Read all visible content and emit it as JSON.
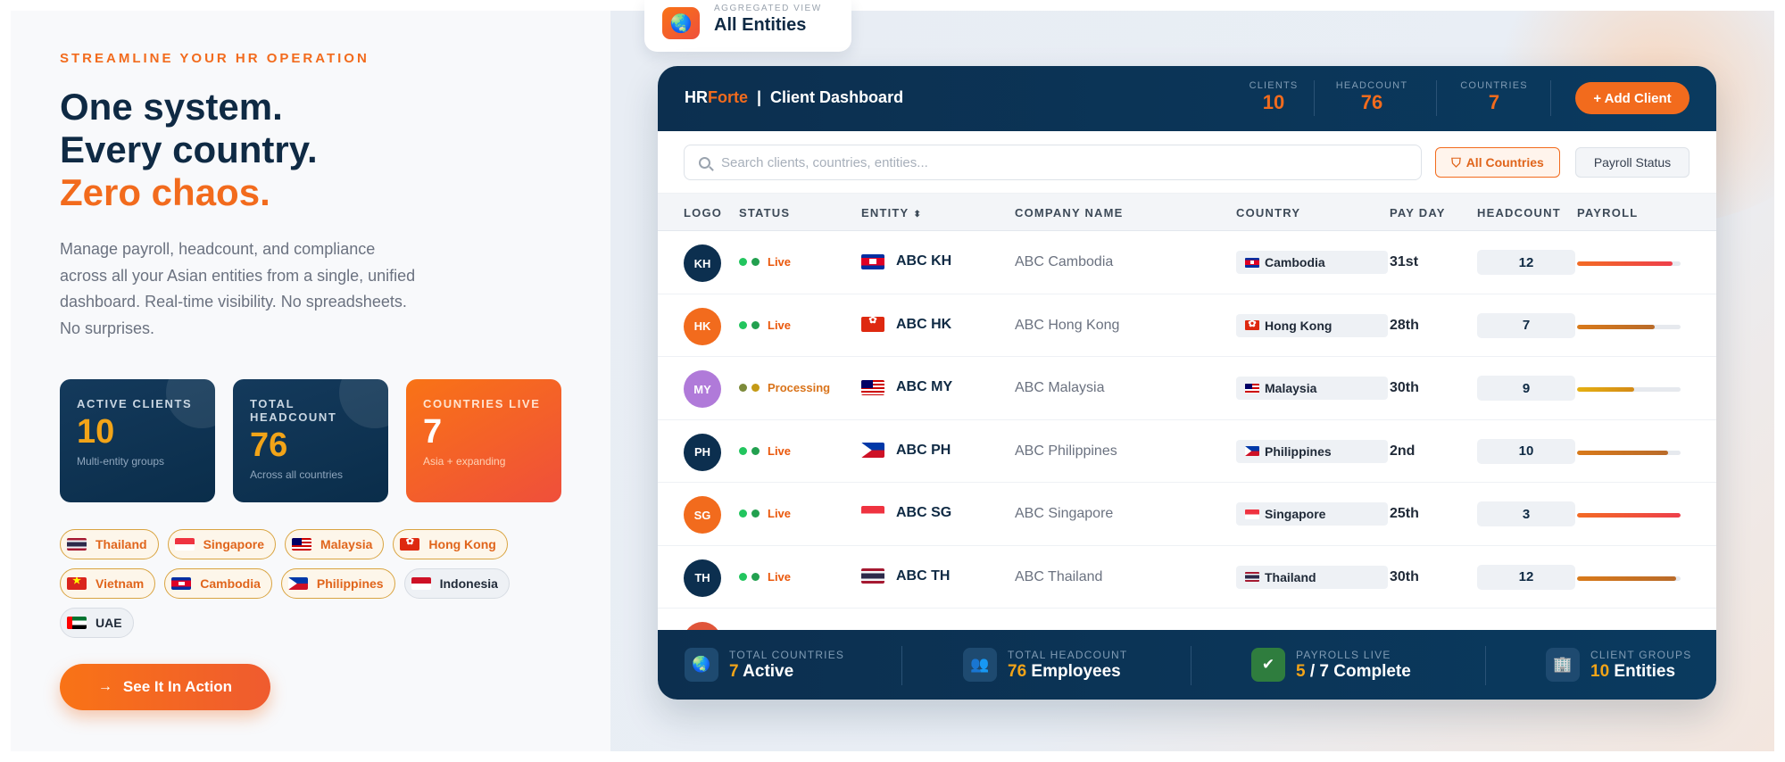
{
  "hero": {
    "eyebrow": "STREAMLINE YOUR HR OPERATION",
    "line1": "One system.",
    "line2": "Every country.",
    "line3": "Zero chaos.",
    "description": "Manage payroll, headcount, and compliance across all your Asian entities from a single, unified dashboard. Real-time visibility. No spreadsheets. No surprises."
  },
  "stat_cards": [
    {
      "label": "ACTIVE CLIENTS",
      "value": "10",
      "sub": "Multi-entity groups"
    },
    {
      "label": "TOTAL HEADCOUNT",
      "value": "76",
      "sub": "Across all countries"
    },
    {
      "label": "COUNTRIES LIVE",
      "value": "7",
      "sub": "Asia + expanding"
    }
  ],
  "country_chips": [
    {
      "label": "Thailand",
      "flag": "th"
    },
    {
      "label": "Singapore",
      "flag": "sg"
    },
    {
      "label": "Malaysia",
      "flag": "my"
    },
    {
      "label": "Hong Kong",
      "flag": "hk"
    },
    {
      "label": "Vietnam",
      "flag": "vn"
    },
    {
      "label": "Cambodia",
      "flag": "kh"
    },
    {
      "label": "Philippines",
      "flag": "ph"
    },
    {
      "label": "Indonesia",
      "flag": "id"
    },
    {
      "label": "UAE",
      "flag": "ae"
    }
  ],
  "cta": {
    "label": "See It In Action",
    "icon": "arrow-right-icon"
  },
  "top_pill": {
    "kicker": "AGGREGATED VIEW",
    "title": "All Entities",
    "icon": "globe-icon"
  },
  "dashboard": {
    "brand_hr": "HR",
    "brand_forte": "Forte",
    "brand_sep": "|",
    "brand_title": "Client Dashboard",
    "header_stats": [
      {
        "label": "CLIENTS",
        "value": "10"
      },
      {
        "label": "HEADCOUNT",
        "value": "76"
      },
      {
        "label": "COUNTRIES",
        "value": "7"
      }
    ],
    "add_button": "+ Add Client",
    "search_placeholder": "Search clients, countries, entities...",
    "filter_countries": "All Countries",
    "filter_payroll": "Payroll Status",
    "columns": [
      "LOGO",
      "STATUS",
      "ENTITY",
      "COMPANY NAME",
      "COUNTRY",
      "PAY DAY",
      "HEADCOUNT",
      "PAYROLL"
    ],
    "rows": [
      {
        "code": "KH",
        "avatar_color": "#0c2f4f",
        "status": "Live",
        "entity": "ABC KH",
        "company": "ABC Cambodia",
        "country": "Cambodia",
        "flag": "kh",
        "payday": "31st",
        "headcount": "12",
        "payroll_progress": 0.92
      },
      {
        "code": "HK",
        "avatar_color": "#f26b1d",
        "status": "Live",
        "entity": "ABC HK",
        "company": "ABC Hong Kong",
        "country": "Hong Kong",
        "flag": "hk",
        "payday": "28th",
        "headcount": "7",
        "payroll_progress": 0.75
      },
      {
        "code": "MY",
        "avatar_color": "#b07ad9",
        "status": "Processing",
        "entity": "ABC MY",
        "company": "ABC Malaysia",
        "country": "Malaysia",
        "flag": "my",
        "payday": "30th",
        "headcount": "9",
        "payroll_progress": 0.55
      },
      {
        "code": "PH",
        "avatar_color": "#0c2f4f",
        "status": "Live",
        "entity": "ABC PH",
        "company": "ABC Philippines",
        "country": "Philippines",
        "flag": "ph",
        "payday": "2nd",
        "headcount": "10",
        "payroll_progress": 0.88
      },
      {
        "code": "SG",
        "avatar_color": "#f26b1d",
        "status": "Live",
        "entity": "ABC SG",
        "company": "ABC Singapore",
        "country": "Singapore",
        "flag": "sg",
        "payday": "25th",
        "headcount": "3",
        "payroll_progress": 1.0
      },
      {
        "code": "TH",
        "avatar_color": "#0c2f4f",
        "status": "Live",
        "entity": "ABC TH",
        "company": "ABC Thailand",
        "country": "Thailand",
        "flag": "th",
        "payday": "30th",
        "headcount": "12",
        "payroll_progress": 0.96
      }
    ],
    "footer": [
      {
        "icon": "globe-icon",
        "label": "TOTAL COUNTRIES",
        "num": "7",
        "rest": " Active"
      },
      {
        "icon": "people-icon",
        "label": "TOTAL HEADCOUNT",
        "num": "76",
        "rest": " Employees"
      },
      {
        "icon": "checkmark-icon",
        "label": "PAYROLLS LIVE",
        "num": "5",
        "rest": " / 7 Complete"
      },
      {
        "icon": "building-icon",
        "label": "CLIENT GROUPS",
        "num": "10",
        "rest": " Entities"
      }
    ]
  },
  "colors": {
    "accent": "#f26b1d",
    "navy": "#0c2f4f",
    "gold": "#f2a418",
    "live_green": "#22c55e"
  }
}
